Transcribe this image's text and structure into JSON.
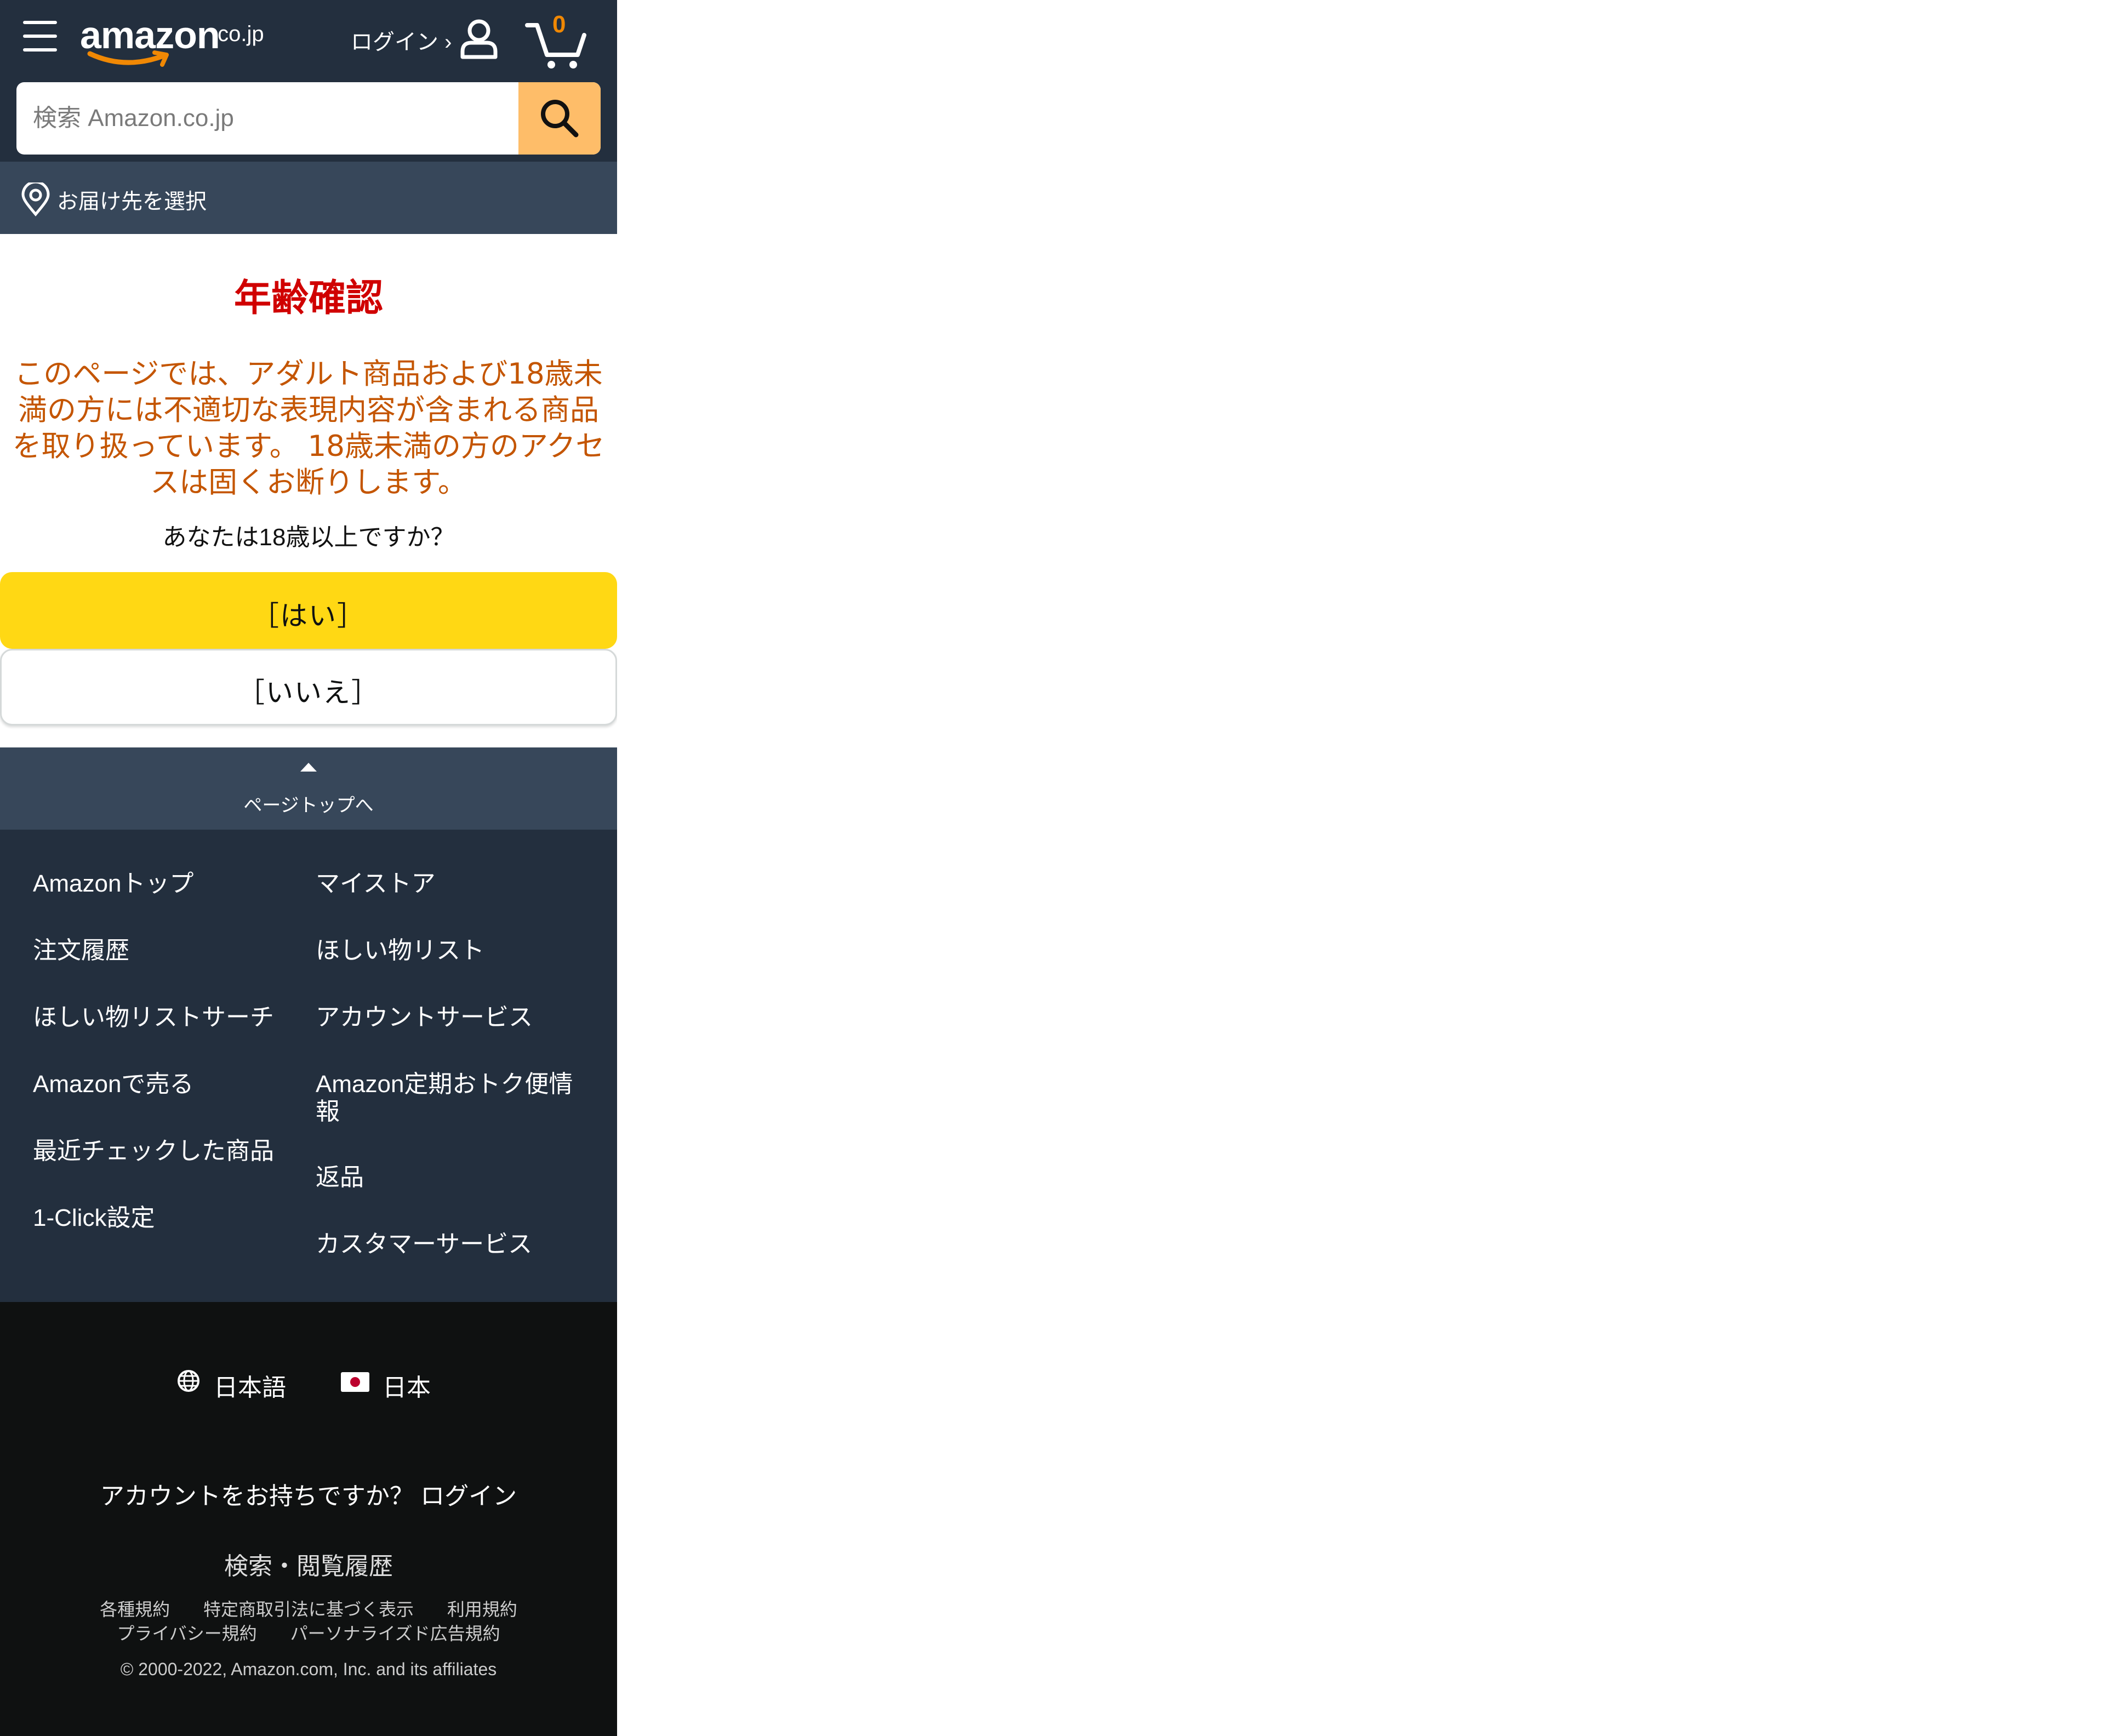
{
  "header": {
    "logo_text": "amazon",
    "logo_tld": ".co.jp",
    "login_label": "ログイン ›",
    "cart_count": "0",
    "search_placeholder": "検索 Amazon.co.jp",
    "deliver_text": "お届け先を選択"
  },
  "age_check": {
    "title": "年齢確認",
    "warning": "このページでは、アダルト商品および18歳未満の方には不適切な表現内容が含まれる商品を取り扱っています。 18歳未満の方のアクセスは固くお断りします。",
    "question": "あなたは18歳以上ですか？",
    "yes_label": "［はい］",
    "no_label": "［いいえ］"
  },
  "footer": {
    "back_to_top": "ページトップへ",
    "links_left": [
      "Amazonトップ",
      "注文履歴",
      "ほしい物リストサーチ",
      "Amazonで売る",
      "最近チェックした商品",
      "1-Click設定"
    ],
    "links_right": [
      "マイストア",
      "ほしい物リスト",
      "アカウントサービス",
      "Amazon定期おトク便情報",
      "返品",
      "カスタマーサービス"
    ],
    "language": "日本語",
    "country": "日本",
    "account_question": "アカウントをお持ちですか？",
    "login_link": "ログイン",
    "history_link": "検索・閲覧履歴",
    "legal_links_row1": [
      "各種規約",
      "特定商取引法に基づく表示",
      "利用規約"
    ],
    "legal_links_row2": [
      "プライバシー規約",
      "パーソナライズド広告規約"
    ],
    "copyright": "© 2000-2022, Amazon.com, Inc. and its affiliates"
  }
}
